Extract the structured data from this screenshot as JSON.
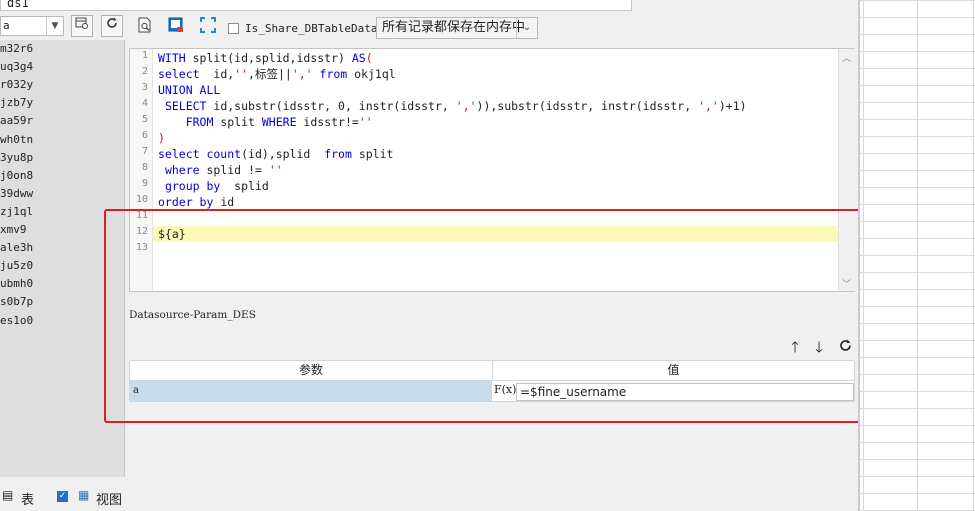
{
  "dataset_name": "ds1",
  "left_panel": {
    "combo_value": "a",
    "items": [
      "m32r6",
      "uq3g4",
      "r032y",
      "jzb7y",
      "aa59r",
      "wh0tn",
      "3yu8p",
      "j0on8",
      "39dww",
      "zj1ql",
      "xmv9",
      "ale3h",
      "ju5z0",
      "ubmh0",
      "s0b7p",
      "es1o0"
    ],
    "bottom_table_label": "表",
    "bottom_view_label": "视图"
  },
  "toolbar": {
    "share_checkbox_label": "Is_Share_DBTableData",
    "cache_option": "所有记录都保存在内存中"
  },
  "editor": {
    "highlighted_line": 12
  },
  "params": {
    "section_label": "Datasource-Param_DES",
    "col_param": "参数",
    "col_value": "值",
    "rows": [
      {
        "name": "a",
        "fx": "F(x)",
        "value": "=$fine_username"
      }
    ]
  },
  "colors": {
    "annotation_box": "#e0201f",
    "highlight_line": "#fbf8b8",
    "param_row": "#c8dcec"
  }
}
